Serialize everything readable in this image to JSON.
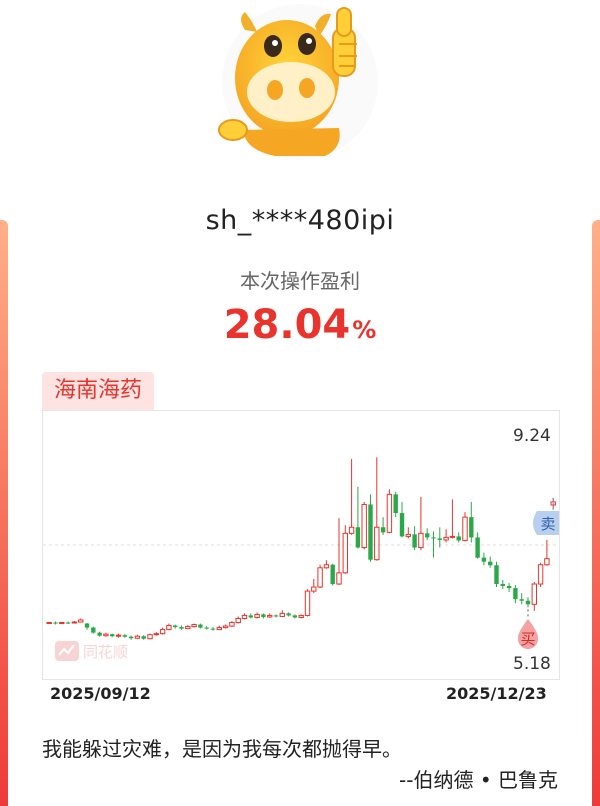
{
  "card": {
    "username": "sh_****480ipi",
    "profit_label": "本次操作盈利",
    "profit_number": "28.04",
    "profit_unit": "%",
    "stock_name": "海南海药"
  },
  "chart_data": {
    "type": "candlestick",
    "price_high_label": "9.24",
    "price_low_label": "5.18",
    "date_start": "2025/09/12",
    "date_end": "2025/12/23",
    "watermark": "同花顺",
    "buy_label": "买",
    "sell_label": "卖",
    "colors": {
      "up": "#e8342c",
      "down": "#2aa84a",
      "grid": "#dddddd",
      "sell": "#5b8fd6"
    },
    "ylim": [
      5.0,
      9.5
    ],
    "candles": [
      [
        5.7,
        5.72,
        5.73,
        5.69
      ],
      [
        5.72,
        5.7,
        5.74,
        5.68
      ],
      [
        5.7,
        5.72,
        5.73,
        5.69
      ],
      [
        5.72,
        5.71,
        5.74,
        5.69
      ],
      [
        5.71,
        5.73,
        5.75,
        5.7
      ],
      [
        5.73,
        5.77,
        5.8,
        5.72
      ],
      [
        5.7,
        5.62,
        5.71,
        5.58
      ],
      [
        5.62,
        5.52,
        5.64,
        5.5
      ],
      [
        5.52,
        5.46,
        5.54,
        5.44
      ],
      [
        5.46,
        5.49,
        5.52,
        5.44
      ],
      [
        5.49,
        5.45,
        5.5,
        5.43
      ],
      [
        5.45,
        5.47,
        5.5,
        5.42
      ],
      [
        5.47,
        5.44,
        5.49,
        5.42
      ],
      [
        5.44,
        5.41,
        5.46,
        5.38
      ],
      [
        5.41,
        5.45,
        5.48,
        5.4
      ],
      [
        5.45,
        5.4,
        5.47,
        5.38
      ],
      [
        5.4,
        5.48,
        5.5,
        5.39
      ],
      [
        5.48,
        5.5,
        5.53,
        5.46
      ],
      [
        5.5,
        5.58,
        5.62,
        5.48
      ],
      [
        5.58,
        5.66,
        5.7,
        5.57
      ],
      [
        5.66,
        5.63,
        5.68,
        5.6
      ],
      [
        5.63,
        5.6,
        5.66,
        5.58
      ],
      [
        5.6,
        5.64,
        5.67,
        5.59
      ],
      [
        5.64,
        5.68,
        5.7,
        5.62
      ],
      [
        5.68,
        5.62,
        5.7,
        5.6
      ],
      [
        5.62,
        5.6,
        5.65,
        5.58
      ],
      [
        5.6,
        5.58,
        5.63,
        5.56
      ],
      [
        5.58,
        5.62,
        5.66,
        5.57
      ],
      [
        5.62,
        5.65,
        5.68,
        5.6
      ],
      [
        5.65,
        5.72,
        5.75,
        5.63
      ],
      [
        5.72,
        5.8,
        5.84,
        5.7
      ],
      [
        5.8,
        5.86,
        5.9,
        5.78
      ],
      [
        5.86,
        5.82,
        5.9,
        5.8
      ],
      [
        5.82,
        5.88,
        5.92,
        5.8
      ],
      [
        5.88,
        5.83,
        5.9,
        5.8
      ],
      [
        5.83,
        5.86,
        5.9,
        5.81
      ],
      [
        5.86,
        5.84,
        5.88,
        5.82
      ],
      [
        5.84,
        5.9,
        5.96,
        5.83
      ],
      [
        5.9,
        5.86,
        5.92,
        5.84
      ],
      [
        5.86,
        5.82,
        5.88,
        5.8
      ],
      [
        5.82,
        5.86,
        5.88,
        5.8
      ],
      [
        5.86,
        6.34,
        6.38,
        5.84
      ],
      [
        6.34,
        6.42,
        6.58,
        6.3
      ],
      [
        6.42,
        6.8,
        6.86,
        6.4
      ],
      [
        6.8,
        6.86,
        6.95,
        6.78
      ],
      [
        6.86,
        6.48,
        6.88,
        6.45
      ],
      [
        6.48,
        6.7,
        7.78,
        6.46
      ],
      [
        6.7,
        7.48,
        7.64,
        6.68
      ],
      [
        7.48,
        7.6,
        8.95,
        7.45
      ],
      [
        7.6,
        7.2,
        8.4,
        7.18
      ],
      [
        7.2,
        8.05,
        8.1,
        7.16
      ],
      [
        8.05,
        6.96,
        8.25,
        6.92
      ],
      [
        6.96,
        7.6,
        8.98,
        6.94
      ],
      [
        7.6,
        7.5,
        7.8,
        7.45
      ],
      [
        7.5,
        8.25,
        8.35,
        7.48
      ],
      [
        8.25,
        7.88,
        8.3,
        7.8
      ],
      [
        7.88,
        7.42,
        8.1,
        7.4
      ],
      [
        7.42,
        7.46,
        7.6,
        7.38
      ],
      [
        7.46,
        7.2,
        7.62,
        7.15
      ],
      [
        7.2,
        7.48,
        8.2,
        7.15
      ],
      [
        7.48,
        7.4,
        7.58,
        7.35
      ],
      [
        7.4,
        7.38,
        7.52,
        7.0
      ],
      [
        7.38,
        7.35,
        7.6,
        7.2
      ],
      [
        7.35,
        7.4,
        7.56,
        7.3
      ],
      [
        7.4,
        7.42,
        8.15,
        7.38
      ],
      [
        7.42,
        7.34,
        7.5,
        7.3
      ],
      [
        7.34,
        7.8,
        7.9,
        7.32
      ],
      [
        7.8,
        7.4,
        8.1,
        7.3
      ],
      [
        7.4,
        7.0,
        7.5,
        6.98
      ],
      [
        7.0,
        6.92,
        7.1,
        6.85
      ],
      [
        6.92,
        6.85,
        7.02,
        6.8
      ],
      [
        6.85,
        6.48,
        6.92,
        6.42
      ],
      [
        6.48,
        6.44,
        6.56,
        6.38
      ],
      [
        6.44,
        6.4,
        6.5,
        6.32
      ],
      [
        6.4,
        6.18,
        6.46,
        6.1
      ],
      [
        6.18,
        6.15,
        6.3,
        6.08
      ],
      [
        6.15,
        6.08,
        6.22,
        6.02
      ],
      [
        6.08,
        6.48,
        6.52,
        5.95
      ],
      [
        6.48,
        6.86,
        6.9,
        6.42
      ],
      [
        6.86,
        6.98,
        7.35,
        6.84
      ],
      [
        8.04,
        8.1,
        8.18,
        7.96
      ]
    ]
  },
  "quote": {
    "text": "我能躲过灾难，是因为我每次都抛得早。",
    "author": "--伯纳德 • 巴鲁克"
  }
}
